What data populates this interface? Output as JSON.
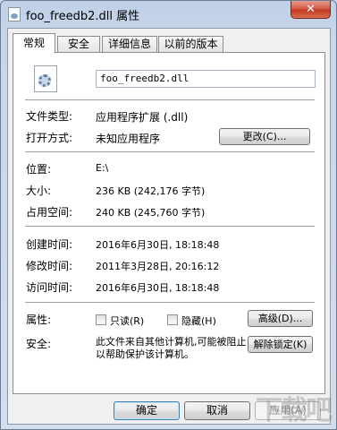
{
  "window": {
    "title": "foo_freedb2.dll 属性",
    "close_label": "✕"
  },
  "tabs": [
    {
      "label": "常规"
    },
    {
      "label": "安全"
    },
    {
      "label": "详细信息"
    },
    {
      "label": "以前的版本"
    }
  ],
  "general": {
    "file_name": "foo_freedb2.dll",
    "file_type_label": "文件类型:",
    "file_type_value": "应用程序扩展 (.dll)",
    "open_with_label": "打开方式:",
    "open_with_value": "未知应用程序",
    "change_button": "更改(C)...",
    "location_label": "位置:",
    "location_value": "E:\\",
    "size_label": "大小:",
    "size_value": "236 KB (242,176 字节)",
    "size_on_disk_label": "占用空间:",
    "size_on_disk_value": "240 KB (245,760 字节)",
    "created_label": "创建时间:",
    "created_value": "2016年6月30日, 18:18:48",
    "modified_label": "修改时间:",
    "modified_value": "2011年3月28日, 20:16:12",
    "accessed_label": "访问时间:",
    "accessed_value": "2016年6月30日, 18:18:48",
    "attributes_label": "属性:",
    "readonly_label": "只读(R)",
    "hidden_label": "隐藏(H)",
    "advanced_button": "高级(D)...",
    "security_label": "安全:",
    "security_text": "此文件来自其他计算机,可能被阻止以帮助保护该计算机。",
    "unblock_button": "解除锁定(K)"
  },
  "footer": {
    "ok": "确定",
    "cancel": "取消",
    "apply": "应用(A)"
  },
  "watermark": "下载吧"
}
